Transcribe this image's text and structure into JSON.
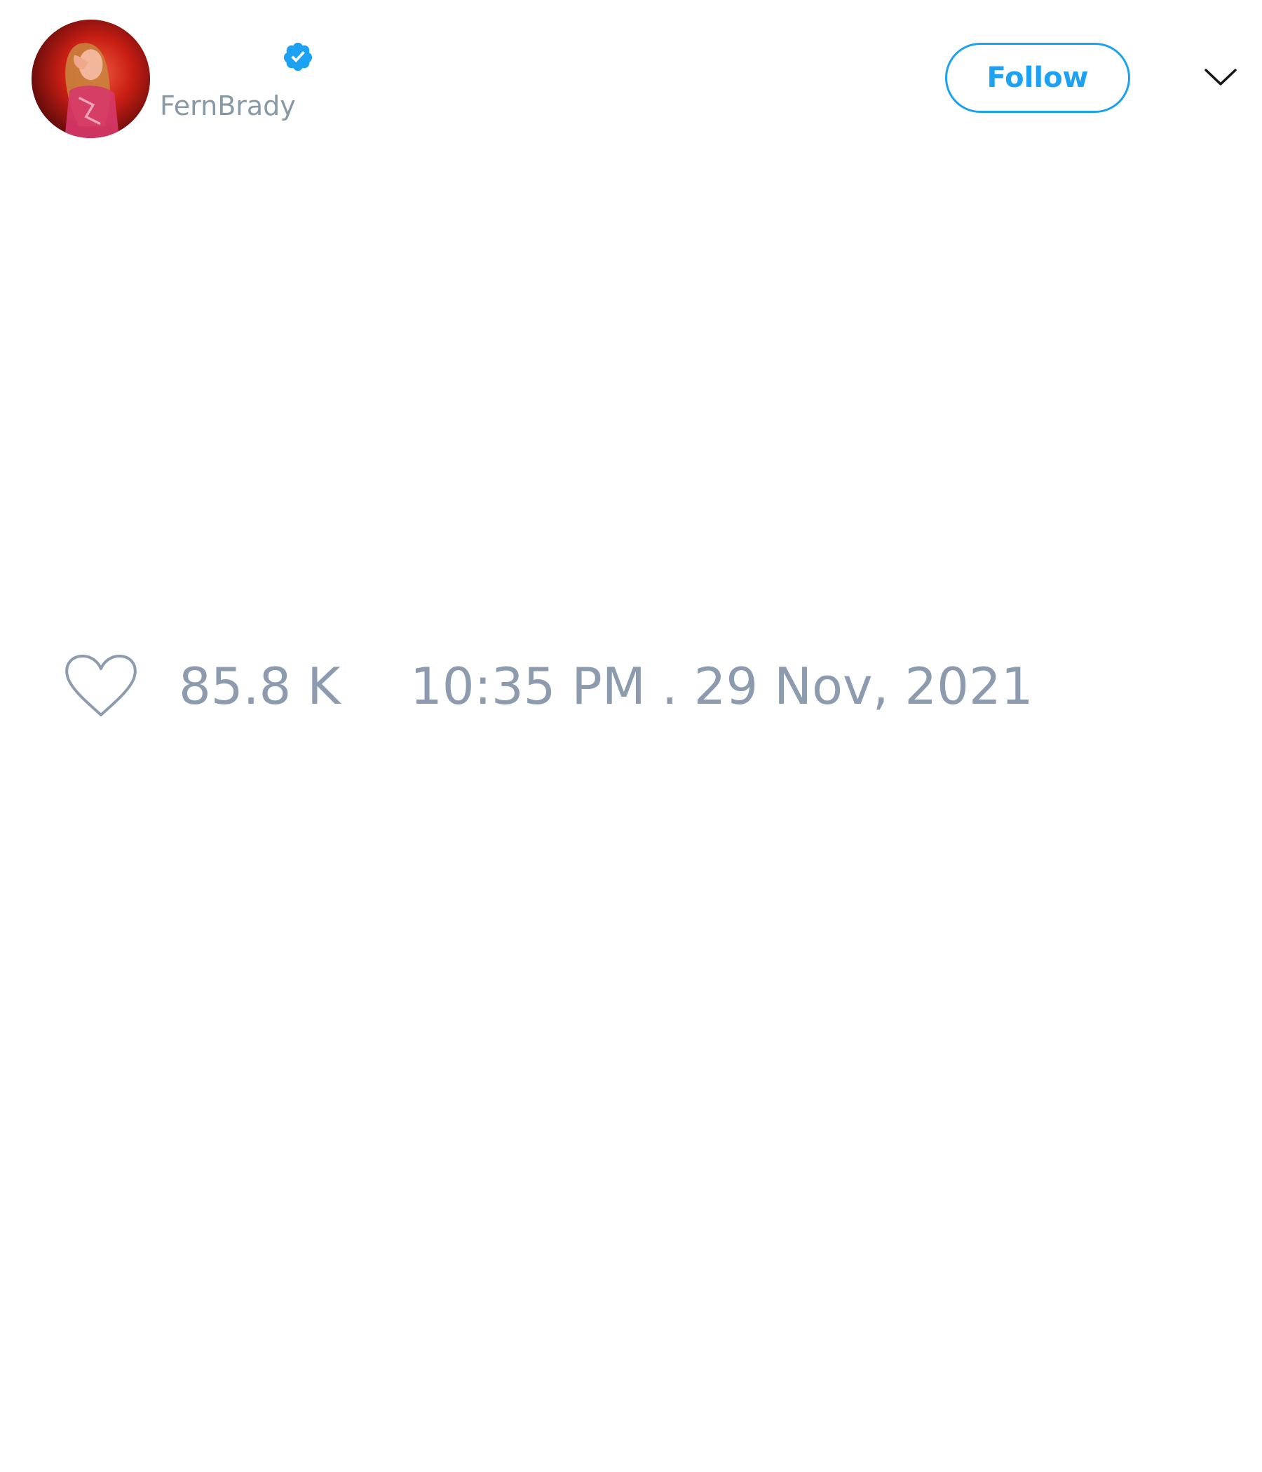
{
  "author": {
    "handle": "FernBrady",
    "verified": true,
    "avatar_icon": "profile-photo"
  },
  "header": {
    "follow_label": "Follow",
    "menu_icon": "chevron-down-icon"
  },
  "stats": {
    "like_icon": "heart-icon",
    "like_count": "85.8 K",
    "timestamp": "10:35 PM . 29 Nov, 2021"
  },
  "colors": {
    "accent": "#1da1f2",
    "muted_text": "#8899a6",
    "stats_text": "#8c9bae",
    "background": "#ffffff"
  }
}
